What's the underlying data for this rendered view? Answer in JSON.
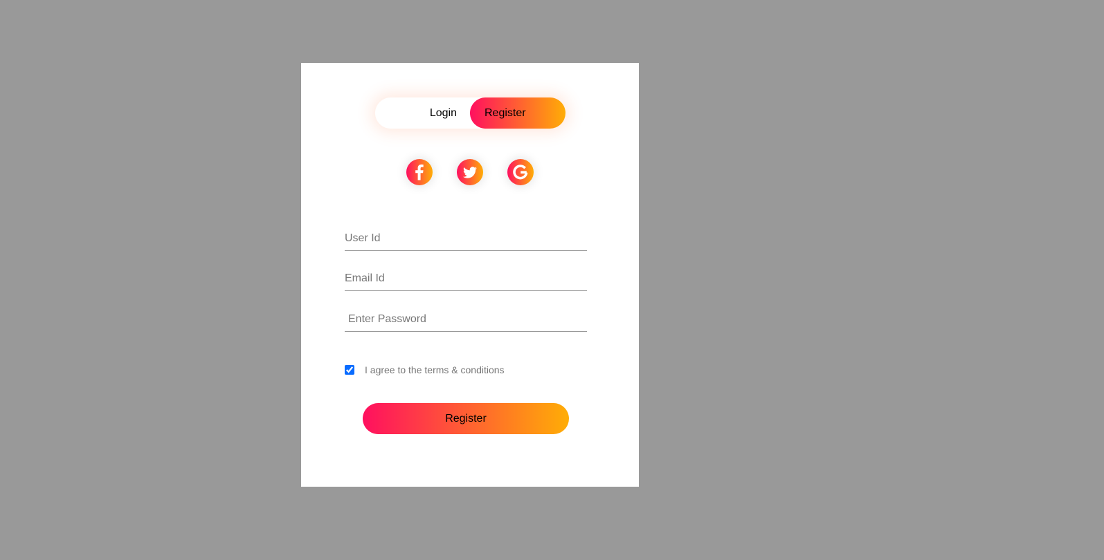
{
  "toggle": {
    "login_label": "Login",
    "register_label": "Register",
    "active": "Register"
  },
  "social": [
    {
      "name": "facebook",
      "icon": "facebook-icon"
    },
    {
      "name": "twitter",
      "icon": "twitter-icon"
    },
    {
      "name": "google",
      "icon": "google-icon"
    }
  ],
  "form": {
    "user_id": {
      "placeholder": "User Id",
      "value": ""
    },
    "email": {
      "placeholder": "Email Id",
      "value": ""
    },
    "password": {
      "placeholder": "Enter Password",
      "value": ""
    },
    "terms_checked": true,
    "terms_label": "I agree to the terms & conditions",
    "submit_label": "Register"
  },
  "colors": {
    "background": "#999999",
    "card": "#ffffff",
    "gradient_start": "#ff105f",
    "gradient_end": "#ffad06",
    "checkbox": "#0a6cff"
  }
}
